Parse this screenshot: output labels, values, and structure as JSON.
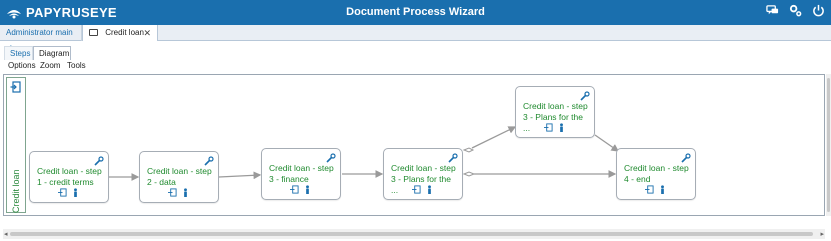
{
  "header": {
    "logo_text": "PAPYRUSEYE",
    "title": "Document Process Wizard",
    "icons": [
      "chat-icon",
      "settings-icon",
      "power-icon"
    ],
    "background": "#1a6fae"
  },
  "tabs": [
    {
      "label": "Administrator main view"
    },
    {
      "label": "Credit loan",
      "close": "✕"
    }
  ],
  "subtabs": [
    {
      "label": "Steps"
    },
    {
      "label": "Diagram"
    }
  ],
  "menu": [
    {
      "label": "Options"
    },
    {
      "label": "Zoom"
    },
    {
      "label": "Tools"
    }
  ],
  "lane": {
    "label": "Credit loan"
  },
  "nodes": [
    {
      "label": "Credit loan - step 1 - credit terms"
    },
    {
      "label": "Credit loan - step 2 - data"
    },
    {
      "label": "Credit loan - step 3 - finance"
    },
    {
      "label": "Credit loan - step 3 - Plans for the ..."
    },
    {
      "label": "Credit loan - step 3 - Plans for the ..."
    },
    {
      "label": "Credit loan - step 4 - end"
    }
  ],
  "colors": {
    "accent": "#1a6fae",
    "step_text": "#1f8a2e",
    "connector": "#9a9a9a"
  },
  "scroll": {
    "left_arrow": "◂",
    "right_arrow": "▸"
  }
}
